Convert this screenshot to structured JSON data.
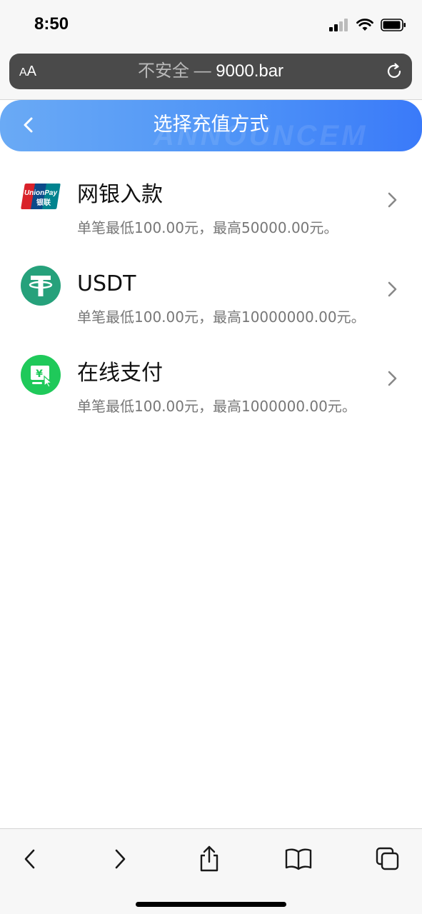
{
  "status_bar": {
    "time": "8:50"
  },
  "browser": {
    "aa_label_small": "A",
    "aa_label_large": "A",
    "url_prefix": "不安全 — ",
    "url_domain": "9000.bar"
  },
  "header": {
    "title": "选择充值方式",
    "watermark": "ANNOUNCEM",
    "gradient_start": "#6aaaf5",
    "gradient_end": "#3a7af9"
  },
  "payment_methods": [
    {
      "name": "网银入款",
      "limit": "单笔最低100.00元，最高50000.00元。",
      "icon": "unionpay-icon"
    },
    {
      "name": "USDT",
      "limit": "单笔最低100.00元，最高10000000.00元。",
      "icon": "tether-icon"
    },
    {
      "name": "在线支付",
      "limit": "单笔最低100.00元，最高1000000.00元。",
      "icon": "online-pay-icon"
    }
  ],
  "colors": {
    "tether": "#26a17b",
    "online_pay": "#1fc95a",
    "unionpay_red": "#d9222a",
    "unionpay_blue": "#0c4a8a",
    "unionpay_teal": "#00838f"
  }
}
